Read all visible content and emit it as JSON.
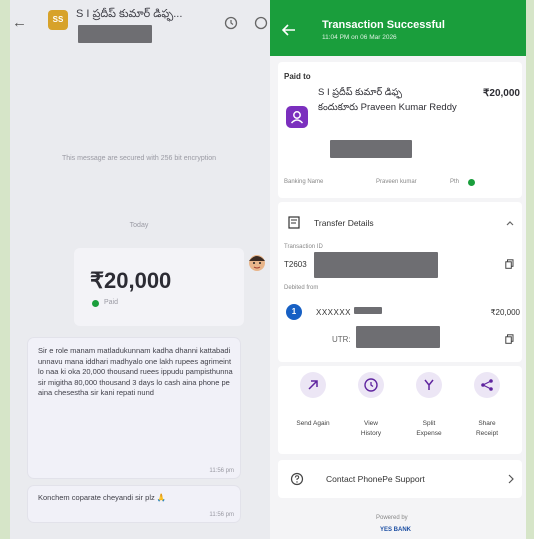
{
  "chat": {
    "back_arrow": "←",
    "contact_initials": "SS",
    "contact_name": "S I ప్రదీప్ కుమార్ డిఫ్ఫ...",
    "notice": "This message are secured with 256 bit encryption",
    "date_label": "Today",
    "payment_amount": "₹20,000",
    "payment_status": "Paid",
    "message_1": "Sir e role manam matladukunnam kadha dhanni kattabadi unnavu mana iddhari madhyalo one lakh rupees agrimeint lo naa ki oka 20,000 thousand ruees ippudu pampisthunna sir migitha 80,000 thousand 3 days lo cash aina phone pe aina chesestha sir kani repati nund",
    "message_1_time": "11:56 pm",
    "message_2": "Konchem coparate cheyandi sir plz 🙏",
    "message_2_time": "11:56 pm"
  },
  "txn": {
    "header_title": "Transaction Successful",
    "header_subtitle": "11:04 PM on 06 Mar 2026",
    "paid_to_label": "Paid to",
    "payee_name": "S I ప్రదీప్ కుమార్ డిఫ్ఫ",
    "payee_subname": "కందుకూరు Praveen Kumar Reddy",
    "amount": "₹20,000",
    "banking_label": "Banking Name",
    "banking_name": "Praveen kumar",
    "banking_suffix": "Pth",
    "transfer_details_label": "Transfer Details",
    "transaction_id_label": "Transaction ID",
    "transaction_id_prefix": "T2603",
    "debited_from_label": "Debited from",
    "account_mask": "XXXXXX",
    "debit_amount": "₹20,000",
    "utr_label": "UTR:",
    "actions": [
      {
        "label_1": "Send Again",
        "label_2": ""
      },
      {
        "label_1": "View",
        "label_2": "History"
      },
      {
        "label_1": "Split",
        "label_2": "Expense"
      },
      {
        "label_1": "Share",
        "label_2": "Receipt"
      }
    ],
    "support_label": "Contact PhonePe Support",
    "powered_by": "Powered by",
    "powered_brand": "YES BANK"
  },
  "colors": {
    "phonepe_green": "#1a9e3c",
    "phonepe_purple": "#5f259f",
    "accent_purple_light": "#ece6f5"
  }
}
